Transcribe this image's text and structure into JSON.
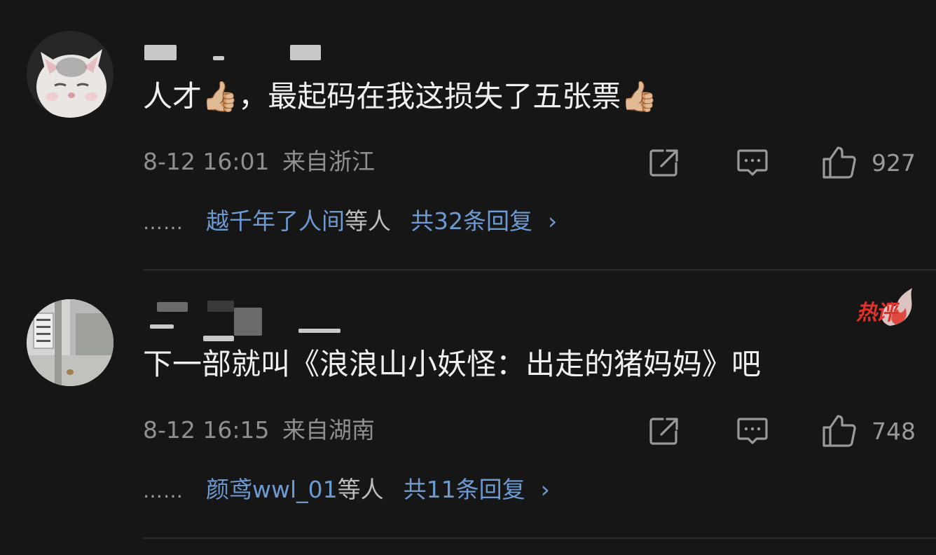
{
  "comments": [
    {
      "text": "人才👍🏼，最起码在我这损失了五张票👍🏼",
      "time": "8-12 16:01",
      "location": "来自浙江",
      "like_count": "927",
      "replies": {
        "dots": "……",
        "names": "越千年了人间",
        "suffix": "等人",
        "count": "共32条回复",
        "chevron": "›"
      }
    },
    {
      "badge": "热评",
      "text": "下一部就叫《浪浪山小妖怪：出走的猪妈妈》吧",
      "time": "8-12 16:15",
      "location": "来自湖南",
      "like_count": "748",
      "replies": {
        "dots": "……",
        "names": "颜鸢wwl_01",
        "suffix": "等人",
        "count": "共11条回复",
        "chevron": "›"
      }
    }
  ],
  "colors": {
    "background": "#161616",
    "link_blue": "#6e9ad2",
    "meta_gray": "#8f8f8f",
    "hot_red": "#e0322c"
  },
  "icons": [
    "share-icon",
    "reply-icon",
    "like-icon"
  ]
}
